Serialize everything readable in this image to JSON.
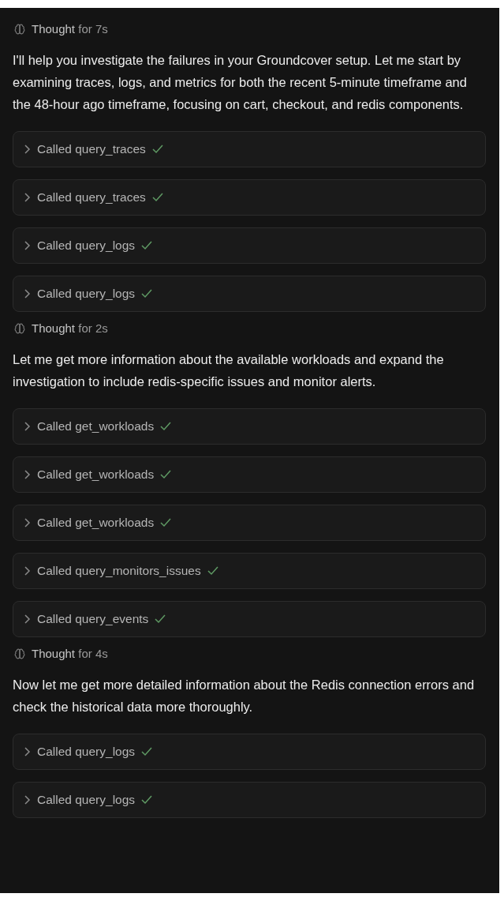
{
  "sections": [
    {
      "thought": {
        "label": "Thought",
        "duration": "for 7s"
      },
      "message": "I'll help you investigate the failures in your Groundcover setup. Let me start by examining traces, logs, and metrics for both the recent 5-minute timeframe and the 48-hour ago timeframe, focusing on cart, checkout, and redis components.",
      "calls": [
        {
          "label": "Called query_traces",
          "done": true
        },
        {
          "label": "Called query_traces",
          "done": true
        },
        {
          "label": "Called query_logs",
          "done": true
        },
        {
          "label": "Called query_logs",
          "done": true
        }
      ]
    },
    {
      "thought": {
        "label": "Thought",
        "duration": "for 2s"
      },
      "message": "Let me get more information about the available workloads and expand the investigation to include redis-specific issues and monitor alerts.",
      "calls": [
        {
          "label": "Called get_workloads",
          "done": true
        },
        {
          "label": "Called get_workloads",
          "done": true
        },
        {
          "label": "Called get_workloads",
          "done": true
        },
        {
          "label": "Called query_monitors_issues",
          "done": true
        },
        {
          "label": "Called query_events",
          "done": true
        }
      ]
    },
    {
      "thought": {
        "label": "Thought",
        "duration": "for 4s"
      },
      "message": "Now let me get more detailed information about the Redis connection errors and check the historical data more thoroughly.",
      "calls": [
        {
          "label": "Called query_logs",
          "done": true
        },
        {
          "label": "Called query_logs",
          "done": true
        }
      ]
    }
  ]
}
